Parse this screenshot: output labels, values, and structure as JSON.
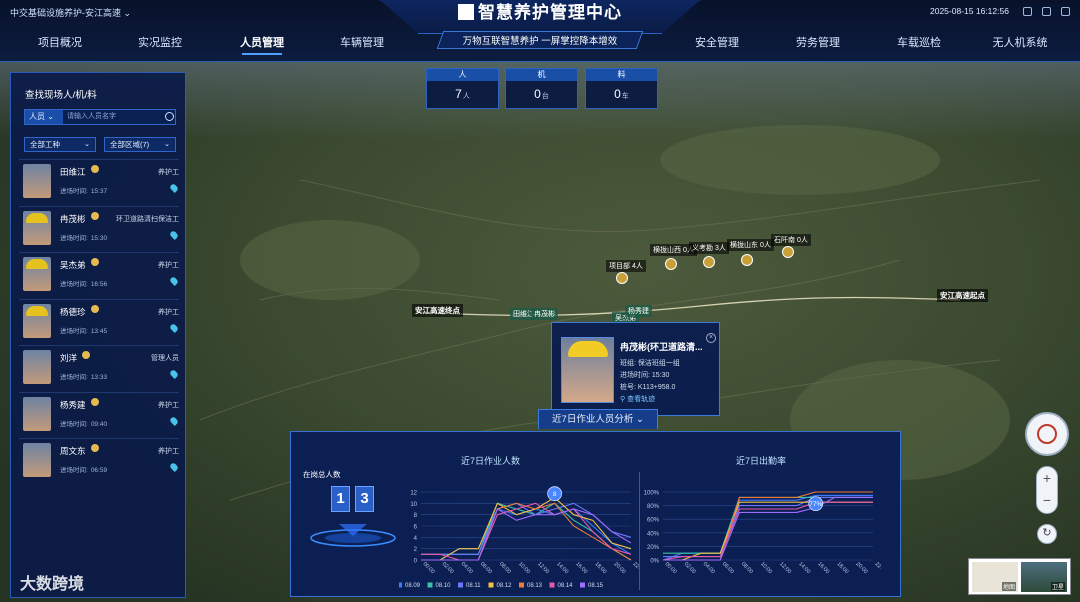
{
  "header": {
    "project": "中交基础设施养护-安江高速",
    "title": "智慧养护管理中心",
    "subtitle": "万物互联智慧养护 一屏掌控降本增效",
    "datetime": "2025-08-15 16:12:56",
    "nav_left": [
      "项目概况",
      "实况监控",
      "人员管理",
      "车辆管理"
    ],
    "nav_right": [
      "安全管理",
      "劳务管理",
      "车载巡检",
      "无人机系统"
    ],
    "active_nav": "人员管理"
  },
  "counters": [
    {
      "label": "人",
      "value": "7",
      "unit": "人"
    },
    {
      "label": "机",
      "value": "0",
      "unit": "台"
    },
    {
      "label": "料",
      "value": "0",
      "unit": "车"
    }
  ],
  "left_panel": {
    "title": "查找现场人/机/料",
    "search_type": "人员",
    "search_placeholder": "请输入人员名字",
    "filter_type": "全部工种",
    "filter_area": "全部区域(7)",
    "time_label": "进场时间:",
    "people": [
      {
        "name": "田维江",
        "role": "养护工",
        "time": "15:37",
        "helmet": false
      },
      {
        "name": "冉茂彬",
        "role": "环卫道路清扫保洁工",
        "time": "15:30",
        "helmet": true
      },
      {
        "name": "吴杰弟",
        "role": "养护工",
        "time": "16:56",
        "helmet": true
      },
      {
        "name": "杨德珍",
        "role": "养护工",
        "time": "13:45",
        "helmet": true
      },
      {
        "name": "刘洋",
        "role": "管理人员",
        "time": "13:33",
        "helmet": false
      },
      {
        "name": "杨秀建",
        "role": "养护工",
        "time": "09:40",
        "helmet": false
      },
      {
        "name": "周文东",
        "role": "养护工",
        "time": "06:59",
        "helmet": false
      }
    ]
  },
  "map_labels": {
    "start": "安江高速起点",
    "end": "安江高速终点",
    "hubs": [
      "项目部 4人",
      "横拢山西 0人",
      "义考勘 3人",
      "横拢山东 0人",
      "石阡南 0人"
    ],
    "people_tags": [
      "田维江",
      "冉茂彬",
      "吴杰弟",
      "杨秀建"
    ]
  },
  "popup": {
    "name": "冉茂彬(环卫道路清...",
    "team_label": "班组:",
    "team": "保洁班组一组",
    "time_label": "进场时间:",
    "time": "15:30",
    "stake_label": "桩号:",
    "stake": "K113+958.0",
    "link": "查看轨迹"
  },
  "analysis": {
    "tab_label": "近7日作业人员分析",
    "total_label": "在岗总人数",
    "total_digits": [
      "1",
      "3"
    ],
    "chart1_title": "近7日作业人数",
    "chart2_title": "近7日出勤率",
    "marker1": "8",
    "marker2": "77%"
  },
  "chart_data": [
    {
      "type": "line",
      "title": "近7日作业人数",
      "x": [
        "00:00",
        "02:00",
        "04:00",
        "06:00",
        "08:00",
        "10:00",
        "12:00",
        "14:00",
        "16:00",
        "18:00",
        "20:00",
        "22:00"
      ],
      "ylim": [
        0,
        12
      ],
      "yticks": [
        0,
        2,
        4,
        6,
        8,
        10,
        12
      ],
      "series": [
        {
          "name": "08.09",
          "color": "#3d7bff",
          "values": [
            0,
            0,
            2,
            2,
            9,
            8,
            9,
            8,
            9,
            6,
            3,
            1
          ]
        },
        {
          "name": "08.10",
          "color": "#38c3a8",
          "values": [
            1,
            1,
            1,
            1,
            10,
            9,
            8,
            10,
            7,
            5,
            2,
            0
          ]
        },
        {
          "name": "08.11",
          "color": "#6a78ff",
          "values": [
            1,
            1,
            1,
            1,
            9,
            10,
            8,
            9,
            10,
            8,
            5,
            4
          ]
        },
        {
          "name": "08.12",
          "color": "#f4c242",
          "values": [
            0,
            0,
            2,
            2,
            10,
            8,
            9,
            11,
            8,
            7,
            3,
            2
          ]
        },
        {
          "name": "08.13",
          "color": "#f07a3a",
          "values": [
            0,
            0,
            0,
            0,
            9,
            10,
            9,
            10,
            6,
            4,
            2,
            0
          ]
        },
        {
          "name": "08.14",
          "color": "#e85aa8",
          "values": [
            1,
            1,
            0,
            0,
            8,
            9,
            10,
            8,
            9,
            5,
            2,
            1
          ]
        },
        {
          "name": "08.15",
          "color": "#a06bff",
          "values": [
            0,
            0,
            0,
            0,
            9,
            7,
            8,
            8,
            9,
            8,
            5,
            3
          ]
        }
      ]
    },
    {
      "type": "line",
      "title": "近7日出勤率",
      "x": [
        "00:00",
        "02:00",
        "04:00",
        "06:00",
        "08:00",
        "10:00",
        "12:00",
        "14:00",
        "16:00",
        "18:00",
        "20:00",
        "22:00"
      ],
      "ylim": [
        0,
        100
      ],
      "yticks": [
        "0%",
        "20%",
        "40%",
        "60%",
        "80%",
        "100%"
      ],
      "series": [
        {
          "name": "08.09",
          "color": "#3d7bff",
          "values": [
            0,
            10,
            10,
            10,
            88,
            88,
            88,
            88,
            95,
            95,
            95,
            95
          ]
        },
        {
          "name": "08.10",
          "color": "#38c3a8",
          "values": [
            10,
            10,
            10,
            10,
            92,
            92,
            92,
            92,
            92,
            92,
            92,
            92
          ]
        },
        {
          "name": "08.11",
          "color": "#6a78ff",
          "values": [
            5,
            5,
            5,
            5,
            80,
            80,
            80,
            80,
            92,
            92,
            92,
            92
          ]
        },
        {
          "name": "08.12",
          "color": "#f4c242",
          "values": [
            0,
            0,
            10,
            10,
            85,
            85,
            85,
            85,
            85,
            85,
            85,
            85
          ]
        },
        {
          "name": "08.13",
          "color": "#f07a3a",
          "values": [
            0,
            0,
            0,
            0,
            92,
            92,
            92,
            92,
            100,
            100,
            100,
            100
          ]
        },
        {
          "name": "08.14",
          "color": "#e85aa8",
          "values": [
            0,
            5,
            5,
            5,
            75,
            75,
            75,
            75,
            85,
            85,
            85,
            85
          ]
        },
        {
          "name": "08.15",
          "color": "#a06bff",
          "values": [
            0,
            0,
            0,
            0,
            70,
            70,
            70,
            70,
            77,
            92,
            92,
            92
          ]
        }
      ]
    }
  ],
  "controls": {
    "layer1": "地图",
    "layer2": "卫星"
  },
  "watermark": "大数跨境"
}
